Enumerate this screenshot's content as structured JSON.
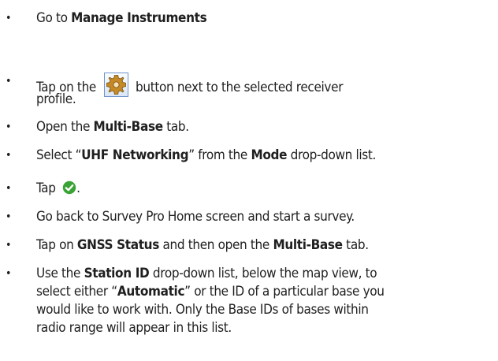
{
  "steps": [
    {
      "pre": "Go to ",
      "bold": "Manage Instruments"
    },
    {
      "pre": "Tap on the ",
      "icon": "gear-settings-icon",
      "line1_post": " button next to the selected receiver",
      "line2": "profile."
    },
    {
      "pre": "Open the ",
      "bold": "Multi-Base",
      "post": " tab."
    },
    {
      "pre": "Select “",
      "bold1": "UHF Networking",
      "mid": "” from the ",
      "bold2": "Mode",
      "post": " drop-down list."
    },
    {
      "pre": "Tap ",
      "icon": "green-check-icon",
      "post": "."
    },
    {
      "text": "Go back to Survey Pro Home screen and start a survey."
    },
    {
      "pre": "Tap on ",
      "bold1": "GNSS Status",
      "mid": " and then open the ",
      "bold2": "Multi-Base",
      "post": " tab."
    },
    {
      "pre": "Use the ",
      "bold1": "Station ID",
      "mid": " drop-down list, below the map view, to",
      "line2_pre": "select either “",
      "bold2": "Automatic",
      "line2_post": "” or the ID of a particular base you",
      "line3": "would like to work with. Only the Base IDs of bases within",
      "line4": "radio range will appear in this list."
    }
  ],
  "bullet_char": "•",
  "colors": {
    "gear": "#c58a26",
    "check": "#3aa335"
  }
}
